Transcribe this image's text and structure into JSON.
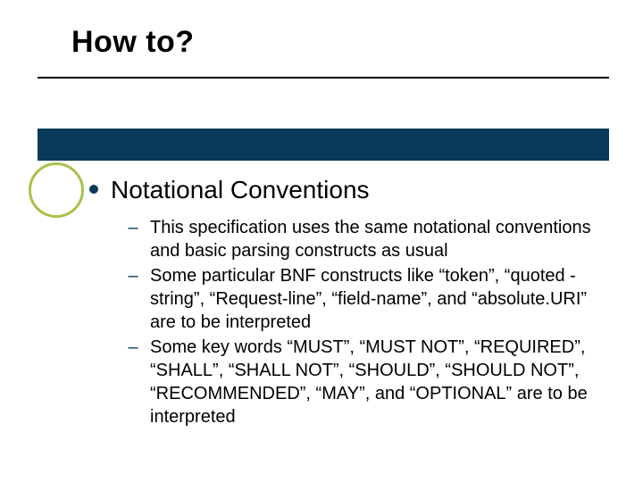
{
  "slide": {
    "title": "How to?",
    "bullet_icon": "dot",
    "heading": "Notational Conventions",
    "dash": "–",
    "items": [
      "This specification uses the same notational conventions and basic parsing constructs as usual",
      "Some particular BNF constructs like “token”, “quoted -string”, “Request-line”, “field-name”, and “absolute.URI” are to be interpreted",
      "Some key words “MUST”, “MUST NOT”, “REQUIRED”, “SHALL”, “SHALL NOT”, “SHOULD”, “SHOULD NOT”, “RECOMMENDED”, “MAY”, and “OPTIONAL” are to be interpreted"
    ]
  }
}
